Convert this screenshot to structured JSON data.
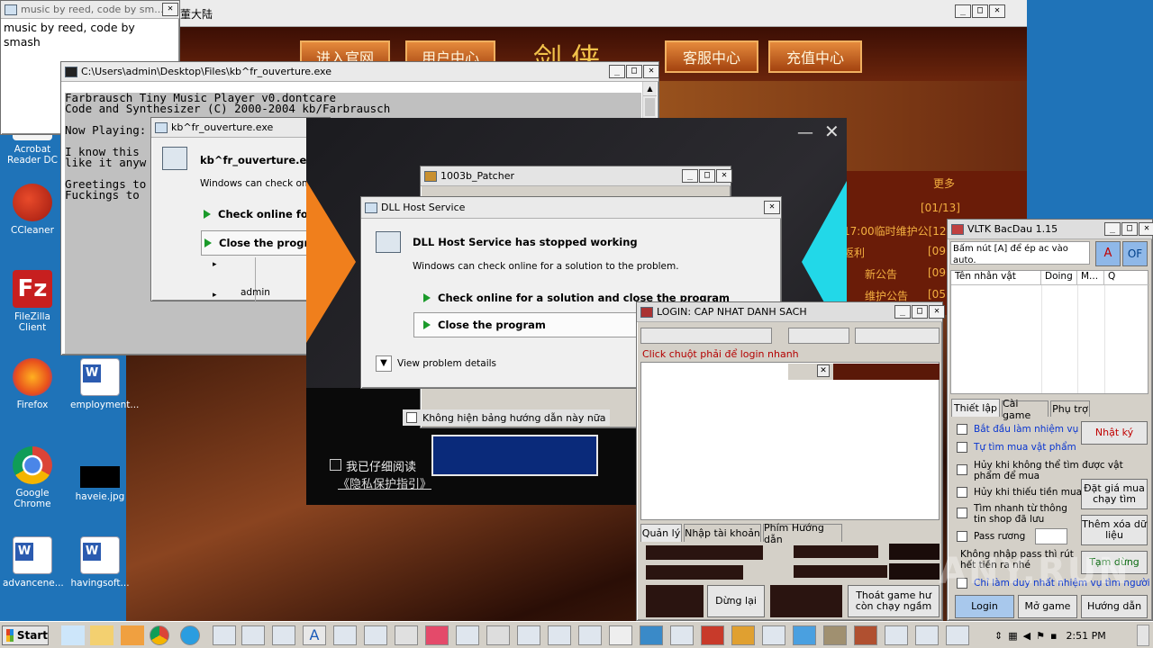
{
  "desktop": {
    "icons": [
      {
        "label": "Acrobat Reader DC",
        "icon": "acrobat-icon",
        "color": "#c61c1c"
      },
      {
        "label": "CCleaner",
        "icon": "ccleaner-icon",
        "color": "#d23a2a"
      },
      {
        "label": "FileZilla Client",
        "icon": "filezilla-icon",
        "color": "#c71f1f"
      },
      {
        "label": "Firefox",
        "icon": "firefox-icon",
        "color": "#f06b1c"
      },
      {
        "label": "employment...",
        "icon": "word-doc-icon",
        "color": "#2b5bb0"
      },
      {
        "label": "Google Chrome",
        "icon": "chrome-icon",
        "color": "#2f8f3a"
      },
      {
        "label": "haveie.jpg",
        "icon": "image-file-icon",
        "color": "#000000"
      },
      {
        "label": "advancene...",
        "icon": "word-doc-icon",
        "color": "#2b5bb0"
      },
      {
        "label": "havingsoft...",
        "icon": "word-doc-icon",
        "color": "#2b5bb0"
      }
    ]
  },
  "music_window": {
    "title": "music by reed, code by sm...",
    "body": "music by reed, code by smash"
  },
  "game_launcher": {
    "title_fragment": "董大陆",
    "nav": [
      "进入官网",
      "用户中心",
      "客服中心",
      "充值中心"
    ],
    "logo_fragment": "剑 侠",
    "more": "更多",
    "news": [
      "[01/13]",
      "17:00临时维护公[12,",
      "返利",
      "[09,",
      "新公告",
      "[09,",
      "维护公告",
      "[05,"
    ],
    "checkbox_text": "我已仔细阅读",
    "privacy_text": "《隐私保护指引》"
  },
  "console": {
    "title": "C:\\Users\\admin\\Desktop\\Files\\kb^fr_ouverture.exe",
    "lines": [
      "Farbrausch Tiny Music Player v0.dontcare",
      "Code and Synthesizer (C) 2000-2004 kb/Farbrausch",
      "",
      "Now Playing:",
      "",
      "I know this",
      "like it anyw",
      "",
      "Greetings to",
      "Fuckings to"
    ]
  },
  "kb_dialog": {
    "title": "kb^fr_ouverture.exe",
    "heading": "kb^fr_ouverture.exe",
    "subtext": "Windows can check onlin",
    "btn_check": "Check online for",
    "btn_close": "Close the progra",
    "user": "admin"
  },
  "patcher": {
    "title": "1003b_Patcher",
    "checkbox_label": "Không hiện bảng hướng dẫn này nữa"
  },
  "dll_dialog": {
    "title": "DLL Host Service",
    "heading": "DLL Host Service has stopped working",
    "subtext": "Windows can check online for a solution to the problem.",
    "btn_check": "Check online for a solution and close the program",
    "btn_close": "Close the program",
    "details": "View problem details"
  },
  "login_window": {
    "title": "LOGIN: CAP NHAT DANH SACH",
    "hint": "Click chuột phải để login nhanh",
    "tabs": [
      "Quản lý",
      "Nhập tài khoản",
      "Phím Hướng dẫn"
    ],
    "btn_stop": "Dừng lại",
    "btn_exit": "Thoát game hư còn chạy ngầm"
  },
  "vltk": {
    "title": "VLTK BacDau 1.15",
    "notice": "Bấm nút [A] để ép ac vào auto.",
    "btn_a": "A",
    "btn_of": "OF",
    "columns": [
      "Tên nhân vật",
      "Doing",
      "M...",
      "Q"
    ],
    "tabs": [
      "Thiết lập",
      "Cài game",
      "Phụ trợ"
    ],
    "options": [
      {
        "label": "Bắt đầu làm nhiệm vụ",
        "blue": true
      },
      {
        "label": "Tự tìm mua vật phẩm",
        "blue": true
      },
      {
        "label": "Hủy khi không thể tìm được vật phẩm để mua",
        "blue": false
      },
      {
        "label": "Hủy khi thiếu tiền mua",
        "blue": false
      },
      {
        "label": "Tìm nhanh từ thông tin shop đã lưu",
        "blue": false
      },
      {
        "label": "Pass rương",
        "blue": false
      }
    ],
    "no_pass_text": "Không nhập pass thì rút hết tiền ra nhé",
    "last_option": "Chỉ làm duy nhất nhiệm vụ tìm người",
    "btn_log": "Nhật ký",
    "btn_price": "Đặt giá mua chạy tìm",
    "btn_clear": "Thêm xóa dữ liệu",
    "btn_pause": "Tạm dừng",
    "btn_login": "Login",
    "btn_open": "Mở game",
    "btn_guide": "Hướng dẫn"
  },
  "watermark": "ANY.RUN",
  "taskbar": {
    "start": "Start",
    "clock": "2:51 PM"
  }
}
